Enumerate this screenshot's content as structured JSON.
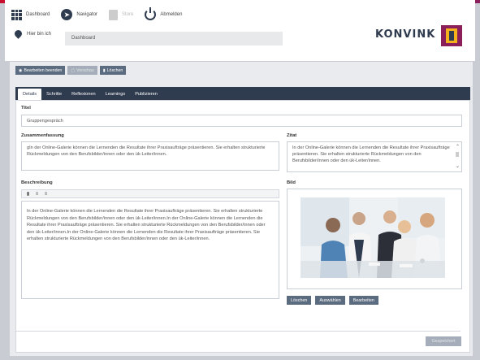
{
  "colors": {
    "strip": [
      "#c8102e",
      "#2d6db5",
      "#f3b21b",
      "#7ab648",
      "#8a1f5b"
    ],
    "primary": "#2f3b4e",
    "button": "#5b6b80"
  },
  "nav": {
    "dashboard": "Dashboard",
    "navigator": "Navigator",
    "save": "Store",
    "logout": "Abmelden"
  },
  "location": {
    "label": "Hier bin ich",
    "breadcrumb": "Dashboard"
  },
  "brand": {
    "name": "KONVINK"
  },
  "toolbar": {
    "finish": "Bearbeiten beenden",
    "preview": "Vorschau",
    "delete": "Löschen"
  },
  "tabs": [
    "Details",
    "Schritte",
    "Reflexionen",
    "Learnings",
    "Publizieren"
  ],
  "form": {
    "title_label": "Titel",
    "title_value": "Gruppengespräch",
    "summary_label": "Zusammenfassung",
    "summary_value": "gIn der Online-Galerie können die Lernenden die Resultate ihrer Praxisaufträge präsentieren. Sie erhalten strukturierte Rückmeldungen von den Berufsbilder/innen oder den ük-Leiter/innen.",
    "quote_label": "Zitat",
    "quote_value": "In der Online-Galerie können die Lernenden die Resultate ihrer Praxisaufträge präsentieren. Sie erhalten strukturierte Rückmeldungen von den Berufsbilder/innen oder den ük-Leiter/innen.",
    "description_label": "Beschreibung",
    "description_value": "In der Online-Galerie können die Lernenden die Resultate ihrer Praxisaufträge präsentieren. Sie erhalten strukturierte Rückmeldungen von den Berufsbilder/innen oder den ük-Leiter/innen.In der Online-Galerie können die Lernenden die Resultate ihrer Praxisaufträge präsentieren. Sie erhalten strukturierte Rückmeldungen von den Berufsbilder/innen oder den ük-Leiter/innen.In der Online-Galerie können die Lernenden die Resultate ihrer Praxisaufträge präsentieren. Sie erhalten strukturierte Rückmeldungen von den Berufsbilder/innen oder den ük-Leiter/innen.",
    "image_label": "Bild"
  },
  "image_buttons": {
    "delete": "Löschen",
    "choose": "Auswählen",
    "edit": "Bearbeiten"
  },
  "footer": {
    "save": "Gespeichert"
  },
  "icons": {
    "dashboard": "grid-icon",
    "navigator": "compass-icon",
    "save": "floppy-icon",
    "logout": "power-icon",
    "location": "pin-icon"
  }
}
